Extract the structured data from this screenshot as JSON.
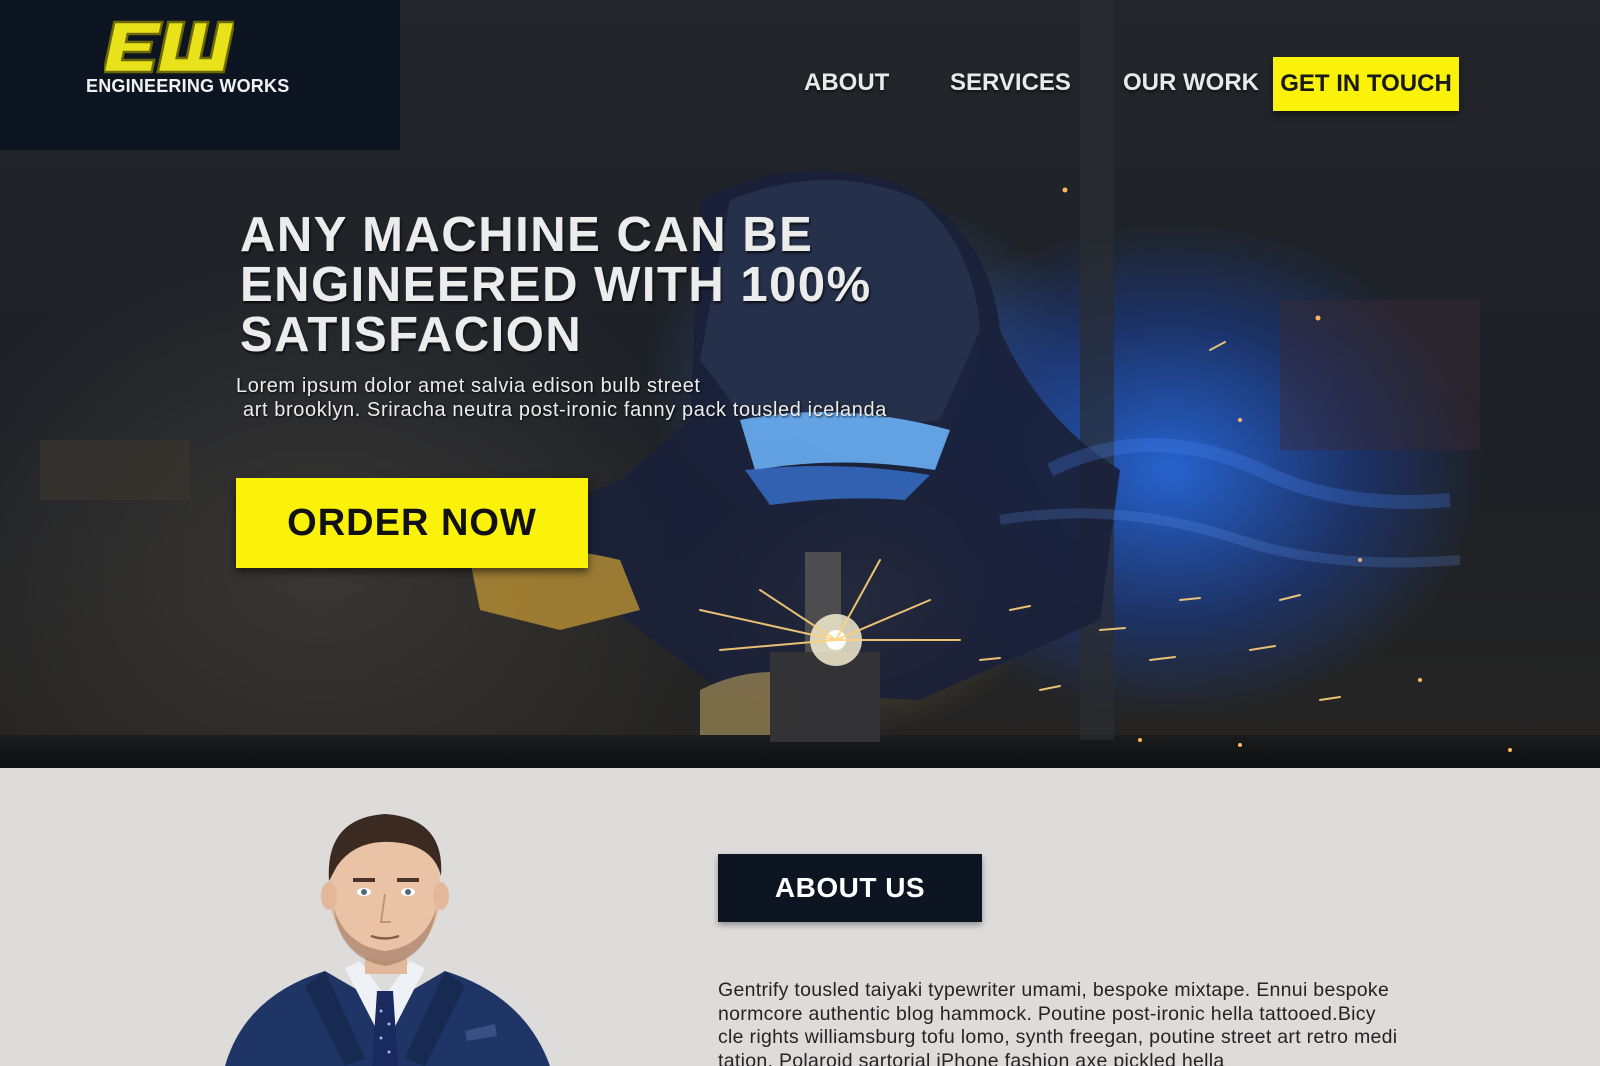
{
  "brand": {
    "monogram": "EW",
    "name": "ENGINEERING WORKS",
    "accent_yellow": "#fbf20a",
    "navy": "#0d1422"
  },
  "nav": {
    "items": [
      {
        "label": "ABOUT"
      },
      {
        "label": "SERVICES"
      },
      {
        "label": "OUR WORK"
      }
    ],
    "cta_label": "GET IN TOUCH"
  },
  "hero": {
    "headline_lines": [
      "ANY MACHINE CAN BE",
      "ENGINEERED WITH 100%",
      "SATISFACION"
    ],
    "subtext_lines": [
      "Lorem ipsum dolor amet salvia edison bulb street",
      "art brooklyn. Sriracha neutra post-ironic fanny pack tousled icelanda"
    ],
    "button_label": "ORDER NOW",
    "background_image": "welder-with-sparks"
  },
  "about": {
    "badge_label": "ABOUT US",
    "portrait": "man-in-navy-suit",
    "paragraph_lines": [
      "Gentrify tousled taiyaki typewriter umami, bespoke mixtape. Ennui bespoke",
      "normcore authentic blog hammock. Poutine post-ironic hella tattooed.Bicy",
      "cle rights williamsburg tofu lomo, synth freegan, poutine  street art retro medi",
      "tation. Polaroid sartorial iPhone fashion axe pickled hella"
    ]
  }
}
